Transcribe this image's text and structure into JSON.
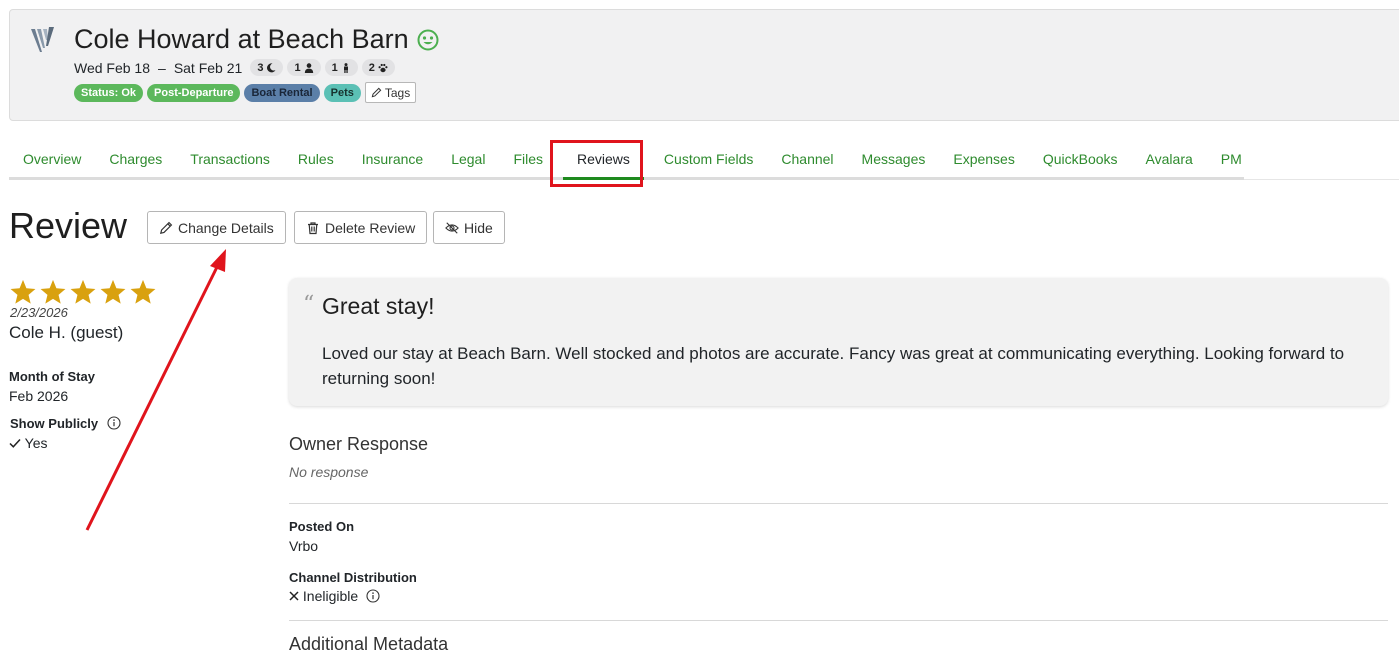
{
  "header": {
    "title": "Cole Howard at Beach Barn",
    "dates": {
      "start": "Wed Feb 18",
      "separator": "–",
      "end": "Sat Feb 21"
    },
    "counts": [
      {
        "value": "3",
        "icon": "moon-icon"
      },
      {
        "value": "1",
        "icon": "adult-icon"
      },
      {
        "value": "1",
        "icon": "child-icon"
      },
      {
        "value": "2",
        "icon": "paw-icon"
      }
    ],
    "tags": [
      {
        "label": "Status: Ok",
        "color": "#5cb85c"
      },
      {
        "label": "Post-Departure",
        "color": "#5cb85c"
      },
      {
        "label": "Boat Rental",
        "color": "#5b7fa8"
      },
      {
        "label": "Pets",
        "color": "#5bc0b5"
      }
    ],
    "tags_button": "Tags"
  },
  "tabs": [
    "Overview",
    "Charges",
    "Transactions",
    "Rules",
    "Insurance",
    "Legal",
    "Files",
    "Reviews",
    "Custom Fields",
    "Channel",
    "Messages",
    "Expenses",
    "QuickBooks",
    "Avalara",
    "PM"
  ],
  "active_tab": "Reviews",
  "review": {
    "heading": "Review",
    "buttons": {
      "change": "Change Details",
      "delete": "Delete Review",
      "hide": "Hide"
    },
    "rating": 5,
    "date": "2/23/2026",
    "reviewer": "Cole H. (guest)",
    "month_of_stay_label": "Month of Stay",
    "month_of_stay": "Feb 2026",
    "show_publicly_label": "Show Publicly",
    "show_publicly": "Yes",
    "quote_title": "Great stay!",
    "quote_body": "Loved our stay at Beach Barn. Well stocked and photos are accurate. Fancy was great at communicating everything. Looking forward to returning soon!",
    "owner_response_title": "Owner Response",
    "owner_response": "No response",
    "posted_on_label": "Posted On",
    "posted_on": "Vrbo",
    "channel_distribution_label": "Channel Distribution",
    "channel_distribution": "Ineligible",
    "additional_metadata": "Additional Metadata"
  },
  "colors": {
    "accent": "#2e8b2e",
    "star": "#d9a10f",
    "highlight": "#e0141c"
  }
}
